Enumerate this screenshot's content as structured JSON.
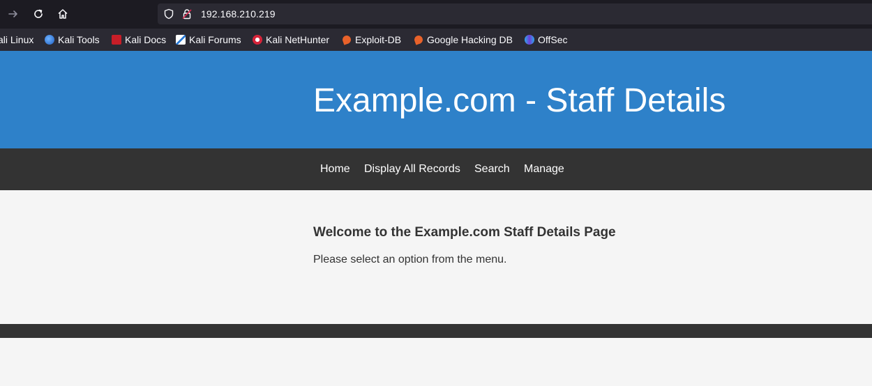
{
  "browser": {
    "url": "192.168.210.219",
    "bookmarks": [
      {
        "label": "ali Linux",
        "icon": "kali-linux-icon"
      },
      {
        "label": "Kali Tools",
        "icon": "kali-tools-icon"
      },
      {
        "label": "Kali Docs",
        "icon": "kali-docs-icon"
      },
      {
        "label": "Kali Forums",
        "icon": "kali-forums-icon"
      },
      {
        "label": "Kali NetHunter",
        "icon": "kali-nethunter-icon"
      },
      {
        "label": "Exploit-DB",
        "icon": "exploit-db-icon"
      },
      {
        "label": "Google Hacking DB",
        "icon": "google-hacking-db-icon"
      },
      {
        "label": "OffSec",
        "icon": "offsec-icon"
      }
    ],
    "colors": {
      "toolbar": "#1c1b22",
      "url_bar": "#2b2a33",
      "bookmarks_bar": "#2b2a33",
      "text": "#fbfbfe"
    }
  },
  "site": {
    "title": "Example.com - Staff Details",
    "nav": [
      "Home",
      "Display All Records",
      "Search",
      "Manage"
    ],
    "welcome_heading": "Welcome to the Example.com Staff Details Page",
    "welcome_text": "Please select an option from the menu.",
    "colors": {
      "header": "#2e81c9",
      "nav": "#333333",
      "content": "#f5f5f5",
      "footer": "#333333"
    }
  }
}
